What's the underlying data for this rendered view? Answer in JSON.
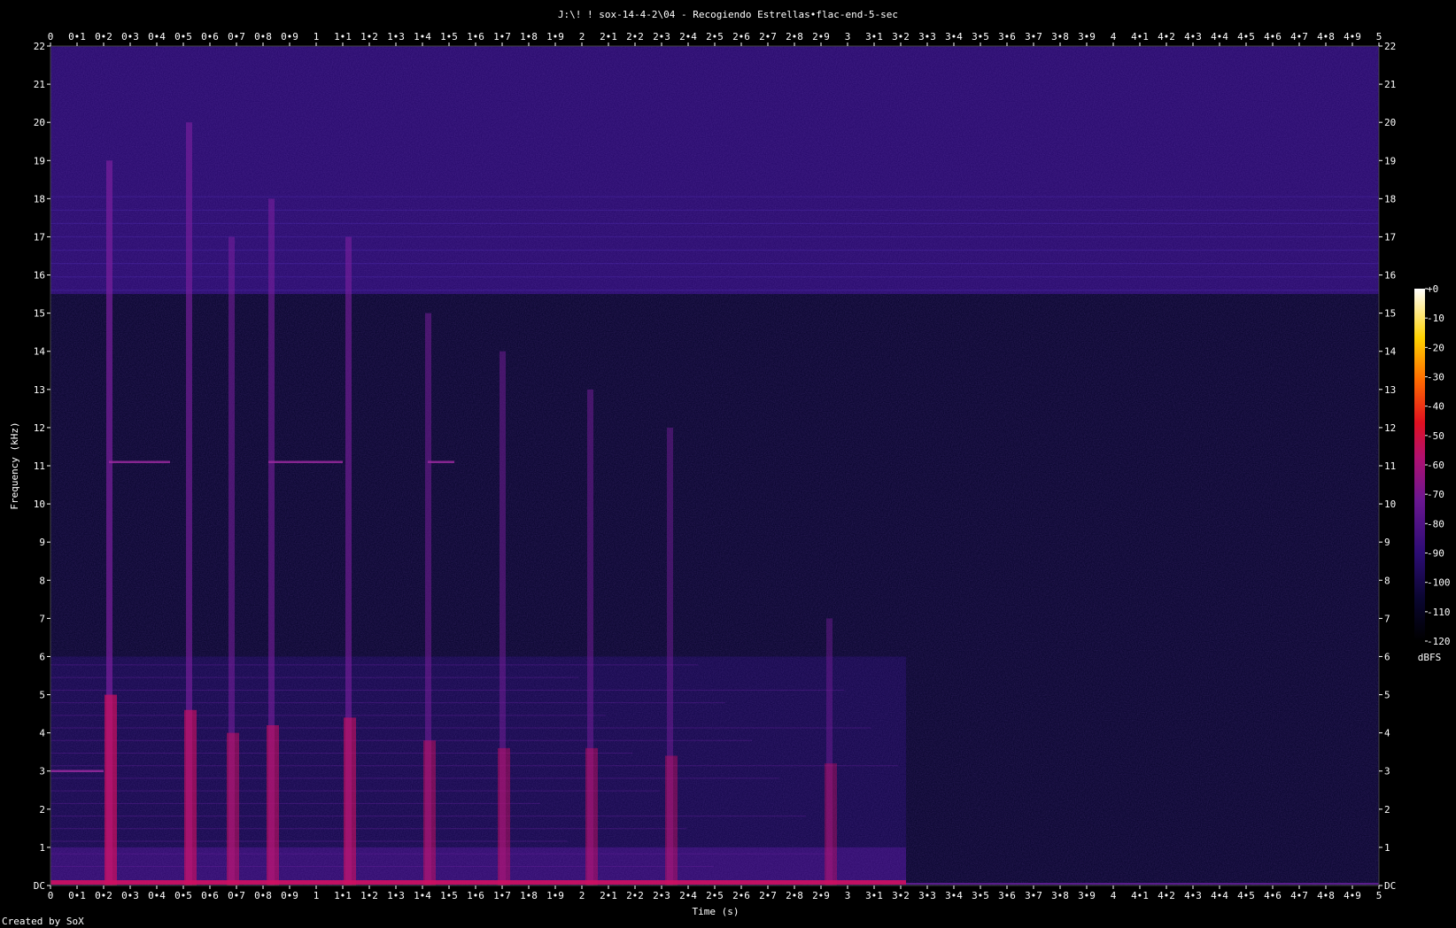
{
  "chart_data": {
    "type": "heatmap",
    "title": "J:\\! ! sox-14-4-2\\04 - Recogiendo Estrellas•flac-end-5-sec",
    "xlabel": "Time (s)",
    "ylabel": "Frequency (kHz)",
    "xlim": [
      0,
      5
    ],
    "ylim": [
      0,
      22
    ],
    "x_ticks": [
      "0",
      "0•1",
      "0•2",
      "0•3",
      "0•4",
      "0•5",
      "0•6",
      "0•7",
      "0•8",
      "0•9",
      "1",
      "1•1",
      "1•2",
      "1•3",
      "1•4",
      "1•5",
      "1•6",
      "1•7",
      "1•8",
      "1•9",
      "2",
      "2•1",
      "2•2",
      "2•3",
      "2•4",
      "2•5",
      "2•6",
      "2•7",
      "2•8",
      "2•9",
      "3",
      "3•1",
      "3•2",
      "3•3",
      "3•4",
      "3•5",
      "3•6",
      "3•7",
      "3•8",
      "3•9",
      "4",
      "4•1",
      "4•2",
      "4•3",
      "4•4",
      "4•5",
      "4•6",
      "4•7",
      "4•8",
      "4•9",
      "5"
    ],
    "y_ticks": [
      "DC",
      "1",
      "2",
      "3",
      "4",
      "5",
      "6",
      "7",
      "8",
      "9",
      "10",
      "11",
      "12",
      "13",
      "14",
      "15",
      "16",
      "17",
      "18",
      "19",
      "20",
      "21",
      "22"
    ],
    "colorbar": {
      "label": "dBFS",
      "range": [
        -120,
        0
      ],
      "ticks": [
        "+0",
        "-10",
        "-20",
        "-30",
        "-40",
        "-50",
        "-60",
        "-70",
        "-80",
        "-90",
        "-100",
        "-110",
        "-120"
      ]
    },
    "noise_floor_dbfs": -100,
    "high_band_noise_above_khz": 15.5,
    "signal_end_s": 3.22,
    "transients": [
      {
        "t": 0.22,
        "max_khz": 19,
        "peak_dbfs": -45
      },
      {
        "t": 0.52,
        "max_khz": 20,
        "peak_dbfs": -55
      },
      {
        "t": 0.68,
        "max_khz": 17,
        "peak_dbfs": -70
      },
      {
        "t": 0.83,
        "max_khz": 18,
        "peak_dbfs": -65
      },
      {
        "t": 1.12,
        "max_khz": 17,
        "peak_dbfs": -60
      },
      {
        "t": 1.42,
        "max_khz": 15,
        "peak_dbfs": -75
      },
      {
        "t": 1.7,
        "max_khz": 14,
        "peak_dbfs": -80
      },
      {
        "t": 2.03,
        "max_khz": 13,
        "peak_dbfs": -80
      },
      {
        "t": 2.33,
        "max_khz": 12,
        "peak_dbfs": -85
      },
      {
        "t": 2.93,
        "max_khz": 7,
        "peak_dbfs": -90
      }
    ],
    "tonal_lines": [
      {
        "khz": 11.1,
        "t_start": 0.22,
        "t_end": 0.45
      },
      {
        "khz": 11.1,
        "t_start": 0.82,
        "t_end": 1.1
      },
      {
        "khz": 11.1,
        "t_start": 1.42,
        "t_end": 1.52
      },
      {
        "khz": 3.0,
        "t_start": 0.0,
        "t_end": 0.2
      }
    ]
  },
  "footer": {
    "credit": "Created by SoX"
  },
  "colors": {
    "background": "#000000",
    "noise_band": "#2a0c6e",
    "low_energy": "#0b0730",
    "signal_mid": "#7a1f9e",
    "signal_high": "#d01060"
  }
}
